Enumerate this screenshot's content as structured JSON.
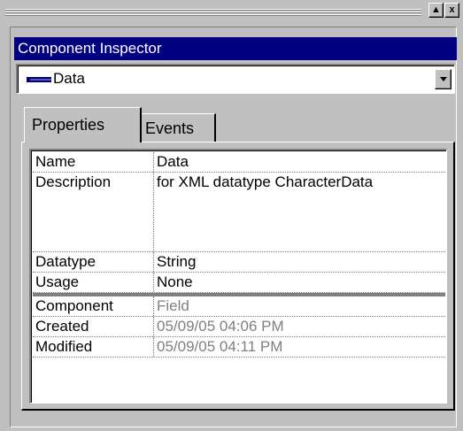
{
  "window": {
    "title": "Component Inspector",
    "restore_glyph": "▲",
    "close_glyph": "x"
  },
  "combo": {
    "value": "Data",
    "icon": "data-type-icon"
  },
  "tabs": [
    {
      "label": "Properties",
      "active": true
    },
    {
      "label": "Events",
      "active": false
    }
  ],
  "properties": {
    "editable": [
      {
        "name": "Name",
        "value": "Data"
      },
      {
        "name": "Description",
        "value": "for XML datatype CharacterData"
      },
      {
        "name": "Datatype",
        "value": "String"
      },
      {
        "name": "Usage",
        "value": "None"
      }
    ],
    "readonly": [
      {
        "name": "Component",
        "value": "Field"
      },
      {
        "name": "Created",
        "value": "05/09/05 04:06 PM"
      },
      {
        "name": "Modified",
        "value": "05/09/05 04:11 PM"
      }
    ]
  },
  "colors": {
    "titlebar": "#000080",
    "face": "#c0c0c0",
    "readonly_text": "#808080"
  }
}
